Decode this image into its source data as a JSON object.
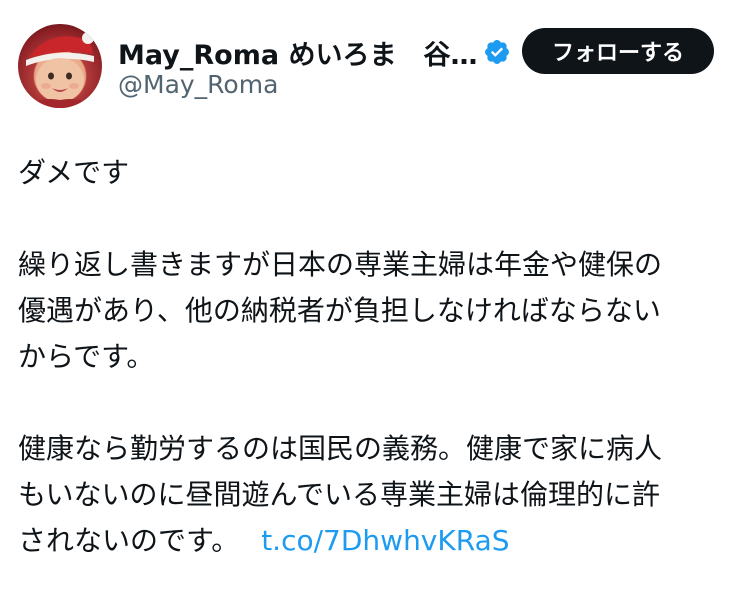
{
  "user": {
    "display_name": "May_Roma めいろま　谷…",
    "handle": "@May_Roma",
    "verified": true,
    "avatar_icon": "profile-photo-baby-santa-hat"
  },
  "follow_button": {
    "label": "フォローする"
  },
  "tweet": {
    "lines": [
      "ダメです",
      "",
      "繰り返し書きますが日本の専業主婦は年金や健保の",
      "優遇があり、他の納税者が負担しなければならない",
      "からです。",
      "",
      "健康なら勤労するのは国民の義務。健康で家に病人",
      "もいないのに昼間遊んでいる専業主婦は倫理的に許",
      "されないのです。"
    ],
    "link_text": "t.co/7DhwhvKRaS"
  },
  "colors": {
    "text": "#0f1419",
    "secondary": "#536471",
    "link": "#1d9bf0",
    "verified_badge": "#1d9bf0",
    "button_bg": "#0f1419",
    "button_text": "#ffffff"
  }
}
